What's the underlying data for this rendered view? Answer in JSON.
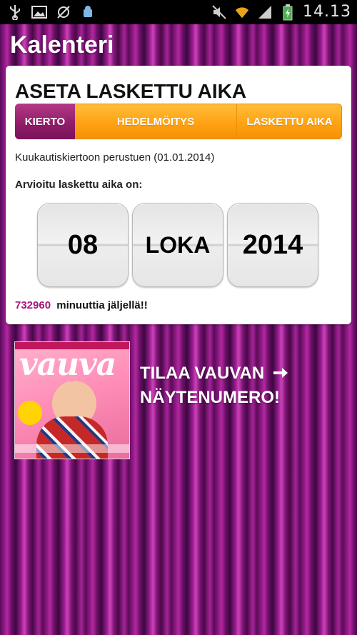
{
  "status_bar": {
    "time": "14.13",
    "icons_left": [
      "usb-icon",
      "image-icon",
      "no-sync-icon",
      "android-debug-icon"
    ],
    "icons_right": [
      "mute-icon",
      "wifi-icon",
      "signal-icon",
      "battery-icon"
    ]
  },
  "app": {
    "title": "Kalenteri"
  },
  "card": {
    "heading": "ASETA LASKETTU AIKA",
    "tabs": [
      "KIERTO",
      "HEDELMÖITYS",
      "LASKETTU AIKA"
    ],
    "selected_tab": "KIERTO",
    "basis_text": "Kuukautiskiertoon perustuen (01.01.2014)",
    "estimate_label": "Arvioitu laskettu aika on:",
    "date": {
      "day": "08",
      "month": "LOKA",
      "year": "2014"
    },
    "remaining_count": "732960",
    "remaining_text": "minuuttia jäljellä!!"
  },
  "promo": {
    "text": "TILAA VAUVAN NÄYTENUMERO!",
    "magazine_logo": "vauva"
  },
  "colors": {
    "accent_purple": "#8e1c68",
    "orange": "#ffa214",
    "count_magenta": "#a8137f",
    "background_stripes": "#9a1e92"
  }
}
